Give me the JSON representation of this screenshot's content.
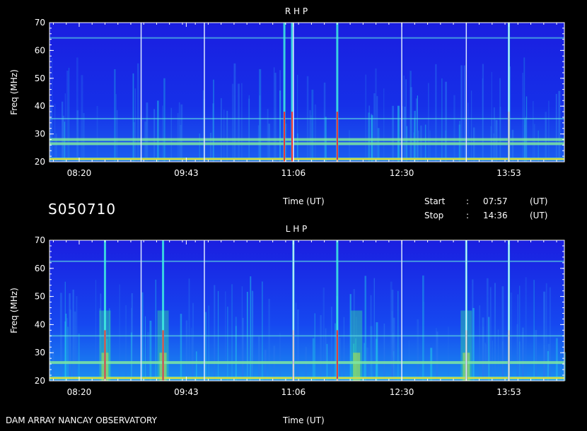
{
  "station_id": "S050710",
  "footer_label": "DAM ARRAY   NANCAY OBSERVATORY",
  "info": {
    "time_label": "Time (UT)",
    "start_label": "Start",
    "start_value": "07:57",
    "stop_label": "Stop",
    "stop_value": "14:36",
    "colon": ":",
    "unit": "(UT)"
  },
  "chart_data": [
    {
      "type": "heatmap",
      "title": "R H P",
      "xlabel": "Time (UT)",
      "ylabel": "Freq (MHz)",
      "xlim": [
        "07:57",
        "14:36"
      ],
      "ylim": [
        20,
        70
      ],
      "x_ticks": [
        "08:20",
        "09:43",
        "11:06",
        "12:30",
        "13:53"
      ],
      "y_ticks": [
        20,
        30,
        40,
        50,
        60,
        70
      ],
      "vertical_markers": [
        "09:08",
        "09:57",
        "11:06",
        "12:30",
        "13:20",
        "13:53"
      ],
      "bright_bursts": [
        "10:59",
        "11:05",
        "11:40",
        "13:53"
      ],
      "horizontal_bands_mhz": [
        21,
        26.5,
        28,
        35.5,
        64.5
      ]
    },
    {
      "type": "heatmap",
      "title": "L H P",
      "xlabel": "Time (UT)",
      "ylabel": "Freq (MHz)",
      "xlim": [
        "07:57",
        "14:36"
      ],
      "ylim": [
        20,
        70
      ],
      "x_ticks": [
        "08:20",
        "09:43",
        "11:06",
        "12:30",
        "13:53"
      ],
      "y_ticks": [
        20,
        30,
        40,
        50,
        60,
        70
      ],
      "vertical_markers": [
        "09:08",
        "09:57",
        "11:06",
        "12:30",
        "13:20",
        "13:53"
      ],
      "bright_bursts": [
        "08:40",
        "09:25",
        "11:06",
        "11:40",
        "13:20",
        "13:53"
      ],
      "horizontal_bands_mhz": [
        21,
        26.5,
        36,
        62.5
      ]
    }
  ]
}
